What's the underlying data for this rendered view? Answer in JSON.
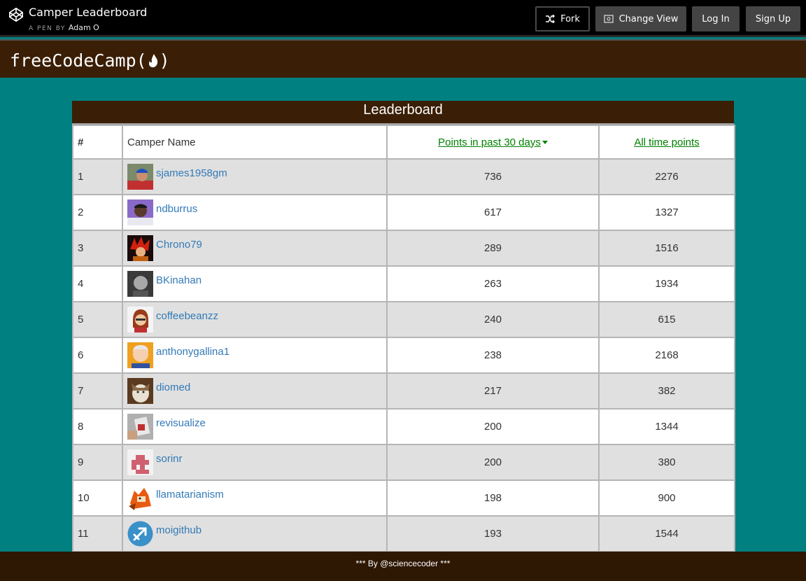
{
  "codepen": {
    "title": "Camper Leaderboard",
    "byline": "A PEN BY",
    "author": "Adam O",
    "buttons": {
      "fork": "Fork",
      "change_view": "Change View",
      "login": "Log In",
      "signup": "Sign Up"
    }
  },
  "navbar": {
    "logo_text": "freeCodeCamp(",
    "logo_close": ")"
  },
  "leaderboard": {
    "title": "Leaderboard",
    "columns": {
      "rank": "#",
      "name": "Camper Name",
      "recent": "Points in past 30 days",
      "alltime": "All time points"
    },
    "rows": [
      {
        "rank": "1",
        "username": "sjames1958gm",
        "recent": "736",
        "alltime": "2276"
      },
      {
        "rank": "2",
        "username": "ndburrus",
        "recent": "617",
        "alltime": "1327"
      },
      {
        "rank": "3",
        "username": "Chrono79",
        "recent": "289",
        "alltime": "1516"
      },
      {
        "rank": "4",
        "username": "BKinahan",
        "recent": "263",
        "alltime": "1934"
      },
      {
        "rank": "5",
        "username": "coffeebeanzz",
        "recent": "240",
        "alltime": "615"
      },
      {
        "rank": "6",
        "username": "anthonygallina1",
        "recent": "238",
        "alltime": "2168"
      },
      {
        "rank": "7",
        "username": "diomed",
        "recent": "217",
        "alltime": "382"
      },
      {
        "rank": "8",
        "username": "revisualize",
        "recent": "200",
        "alltime": "1344"
      },
      {
        "rank": "9",
        "username": "sorinr",
        "recent": "200",
        "alltime": "380"
      },
      {
        "rank": "10",
        "username": "llamatarianism",
        "recent": "198",
        "alltime": "900"
      },
      {
        "rank": "11",
        "username": "moigithub",
        "recent": "193",
        "alltime": "1544"
      }
    ]
  },
  "footer": {
    "text": "*** By @sciencecoder ***"
  },
  "colors": {
    "teal_background": "#008080",
    "brown_bar": "#3a1e05",
    "link_green": "#008000",
    "link_blue": "#337ab7"
  }
}
